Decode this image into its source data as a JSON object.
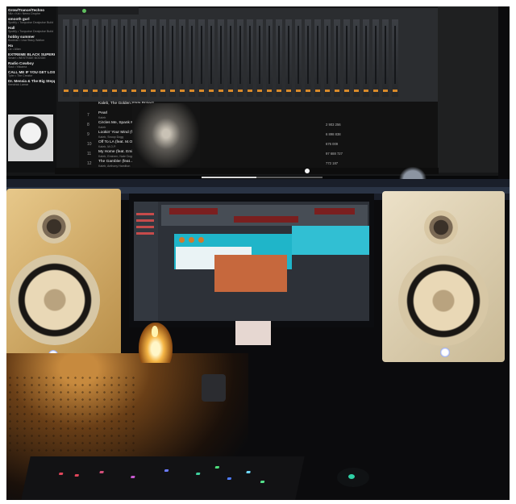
{
  "playlist": {
    "items": [
      {
        "title": "Grow/Trance/Techno",
        "artist": "Nilz • Kai • Nemo Drophe"
      },
      {
        "title": "smooth gurl",
        "artist": "Spotify • Turquoise Dealpulse Build"
      },
      {
        "title": "Hall",
        "artist": "Spotify • Turquoise Dealpulse Build"
      },
      {
        "title": "hobby summer",
        "artist": "Boolean • Lisa Stacy Walton"
      },
      {
        "title": "Ha",
        "artist": "Liz • Allan"
      },
      {
        "title": "EXTREME BLACK SUPERHEROES",
        "artist": "Smart • WESTSIDE BOOGIE"
      },
      {
        "title": "Radio Cowboy",
        "artist": "Soul • Yakama"
      },
      {
        "title": "CALL ME IF YOU GET LOST: The Estate Sale",
        "artist": "Tyler • The Creator"
      },
      {
        "title": "Dr. Mensia & The Big Steppers",
        "artist": "Kendrick Lamar"
      }
    ]
  },
  "tracklist": {
    "rows": [
      {
        "num": "",
        "title": "Kaleb, The Golden State Project",
        "artist": "",
        "plays": ""
      },
      {
        "num": "7",
        "title": "Pearl",
        "artist": "Kaleb",
        "plays": ""
      },
      {
        "num": "8",
        "title": "Circles Me, Spank Me (Feat. ...",
        "artist": "Kaleb",
        "plays": "2 903 256"
      },
      {
        "num": "9",
        "title": "Lookin' Your Mind (feat. Snoop Dogg)",
        "artist": "Kaleb, Snoop Dogg",
        "plays": "6 898 838"
      },
      {
        "num": "10",
        "title": "Off To LA (feat. M.O.P.)",
        "artist": "Kaleb, M.O.P.",
        "plays": "676 009"
      },
      {
        "num": "11",
        "title": "My Home (feat. Eminem & ...)",
        "artist": "Kaleb, Eminem, Nate Dogg",
        "plays": "97 688 727"
      },
      {
        "num": "12",
        "title": "The Gambler (feat. Anthony ...)",
        "artist": "Kaleb, Anthony Hamilton",
        "plays": "772 187"
      }
    ]
  },
  "player": {
    "progress": 0.45
  },
  "colors": {
    "fl_plugin": "#1fb5c9",
    "candle": "#f5b545",
    "speaker_led": "#ffffff",
    "mouse_led": "#2fd1a6"
  }
}
